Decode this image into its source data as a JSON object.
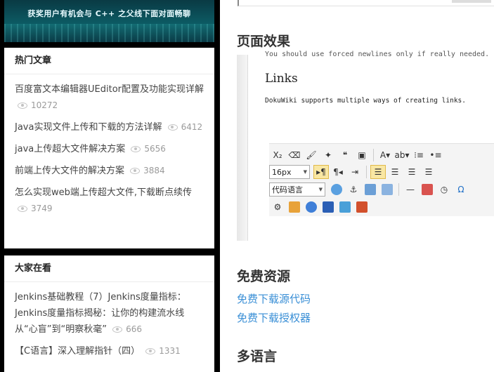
{
  "banner": {
    "text": "获奖用户有机会与 C++ 之父线下面对面畅聊"
  },
  "hot": {
    "title": "热门文章",
    "items": [
      {
        "title": "百度富文本编辑器UEditor配置及功能实现详解",
        "views": "10272"
      },
      {
        "title": "Java实现文件上传和下载的方法详解",
        "views": "6412"
      },
      {
        "title": "java上传超大文件解决方案",
        "views": "5656"
      },
      {
        "title": "前端上传大文件的解决方案",
        "views": "3884"
      },
      {
        "title": "怎么实现web端上传超大文件,下载断点续传",
        "views": "3749"
      }
    ]
  },
  "everyone": {
    "title": "大家在看",
    "items": [
      {
        "title": "Jenkins基础教程（7）Jenkins度量指标：Jenkins度量指标揭秘：让你的构建流水线从“心盲”到“明察秋毫”",
        "views": "666"
      },
      {
        "title": "【C语言】深入理解指针（四）",
        "views": "1331"
      }
    ]
  },
  "main": {
    "effect_heading": "页面效果",
    "preview": {
      "cut_line": "You should use forced newlines only if really needed.",
      "links_heading": "Links",
      "desc": "DokuWiki supports multiple ways of creating links."
    },
    "toolbar": {
      "font_size": "16px",
      "code_language": "代码语言"
    },
    "free_heading": "免费资源",
    "free_links": [
      "免费下载源代码",
      "免费下载授权器"
    ],
    "lang_heading": "多语言"
  }
}
